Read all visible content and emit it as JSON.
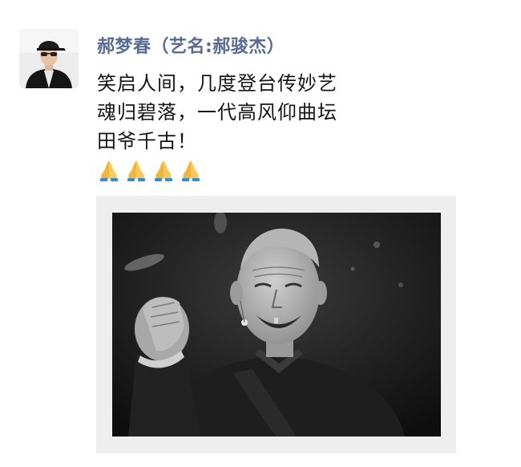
{
  "post": {
    "author_name": "郝梦春（艺名:郝骏杰）",
    "lines": [
      "笑启人间，几度登台传妙艺",
      "魂归碧落，一代高风仰曲坛",
      "田爷千古！"
    ],
    "emoji": [
      "folded-hands",
      "folded-hands",
      "folded-hands",
      "folded-hands"
    ]
  },
  "colors": {
    "author": "#576b95",
    "text": "#151515",
    "card_bg": "#eeeeee",
    "photo_bg": "#1c1c1c"
  }
}
